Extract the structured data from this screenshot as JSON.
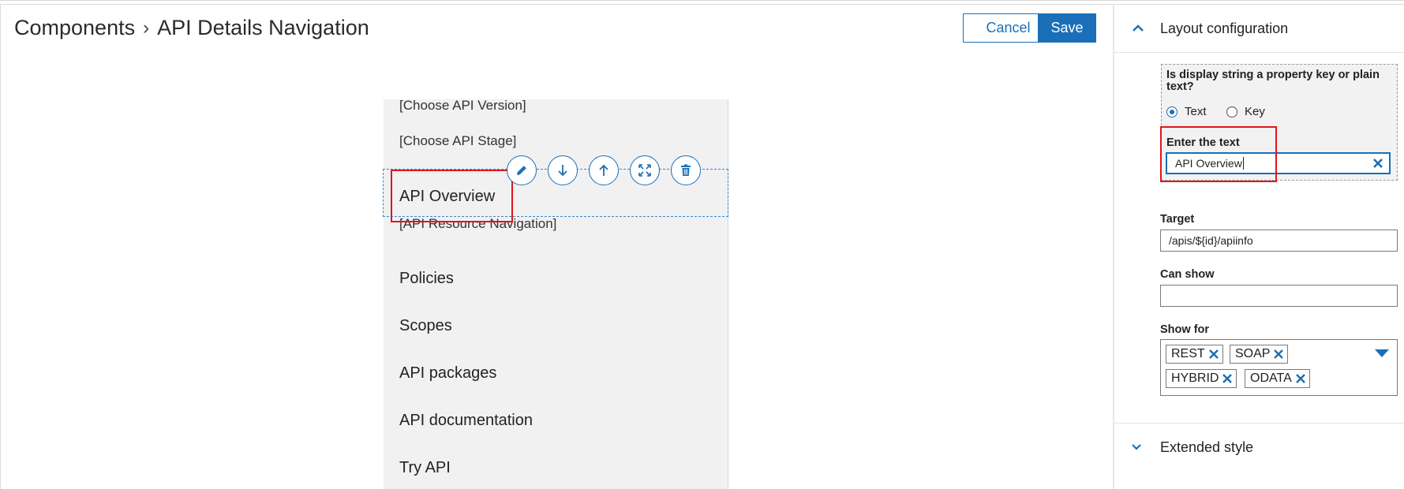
{
  "header": {
    "breadcrumb_root": "Components",
    "breadcrumb_separator": "›",
    "breadcrumb_current": "API Details Navigation",
    "cancel_label": "Cancel",
    "save_label": "Save"
  },
  "canvas": {
    "items": [
      {
        "label": "[Choose API Version]"
      },
      {
        "label": "[Choose API Stage]"
      },
      {
        "label": "API Overview"
      },
      {
        "label": "[API Resource Navigation]"
      },
      {
        "label": "Policies"
      },
      {
        "label": "Scopes"
      },
      {
        "label": "API packages"
      },
      {
        "label": "API documentation"
      },
      {
        "label": "Try API"
      }
    ],
    "toolbar_icons": [
      "edit-icon",
      "move-down-icon",
      "move-up-icon",
      "expand-icon",
      "delete-icon"
    ]
  },
  "sidebar": {
    "layout_section": {
      "title": "Layout configuration",
      "expanded": true
    },
    "display_question": "Is display string a property key or plain text?",
    "radio_text_label": "Text",
    "radio_key_label": "Key",
    "radio_selected": "Text",
    "enter_text_label": "Enter the text",
    "enter_text_value": "API Overview",
    "target_label": "Target",
    "target_value": "/apis/${id}/apiinfo",
    "can_show_label": "Can show",
    "can_show_value": "",
    "show_for_label": "Show for",
    "show_for_tags": [
      "REST",
      "SOAP",
      "HYBRID",
      "ODATA"
    ],
    "extended_section": {
      "title": "Extended style",
      "expanded": false
    }
  },
  "colors": {
    "accent": "#1a6fb8",
    "highlight_red": "#e0161f",
    "canvas_bg": "#f1f1f1"
  }
}
